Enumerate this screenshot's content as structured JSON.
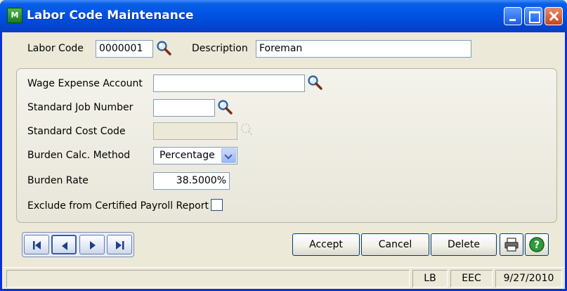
{
  "window": {
    "title": "Labor Code Maintenance",
    "app_icon": "M"
  },
  "header": {
    "labor_code_label": "Labor Code",
    "labor_code_value": "0000001",
    "description_label": "Description",
    "description_value": "Foreman"
  },
  "details": {
    "wage_expense_label": "Wage Expense Account",
    "wage_expense_value": "",
    "std_job_label": "Standard Job Number",
    "std_job_value": "",
    "std_cost_label": "Standard Cost Code",
    "std_cost_value": "",
    "burden_method_label": "Burden Calc. Method",
    "burden_method_value": "Percentage",
    "burden_rate_label": "Burden Rate",
    "burden_rate_value": "38.5000%",
    "exclude_label": "Exclude from Certified Payroll Report",
    "exclude_checked": false
  },
  "buttons": {
    "accept": "Accept",
    "cancel": "Cancel",
    "delete": "Delete"
  },
  "status": {
    "user": "LB",
    "company": "EEC",
    "date": "9/27/2010"
  },
  "icons": {
    "lookup": "magnifier-icon",
    "print": "printer-icon",
    "help": "help-icon"
  }
}
